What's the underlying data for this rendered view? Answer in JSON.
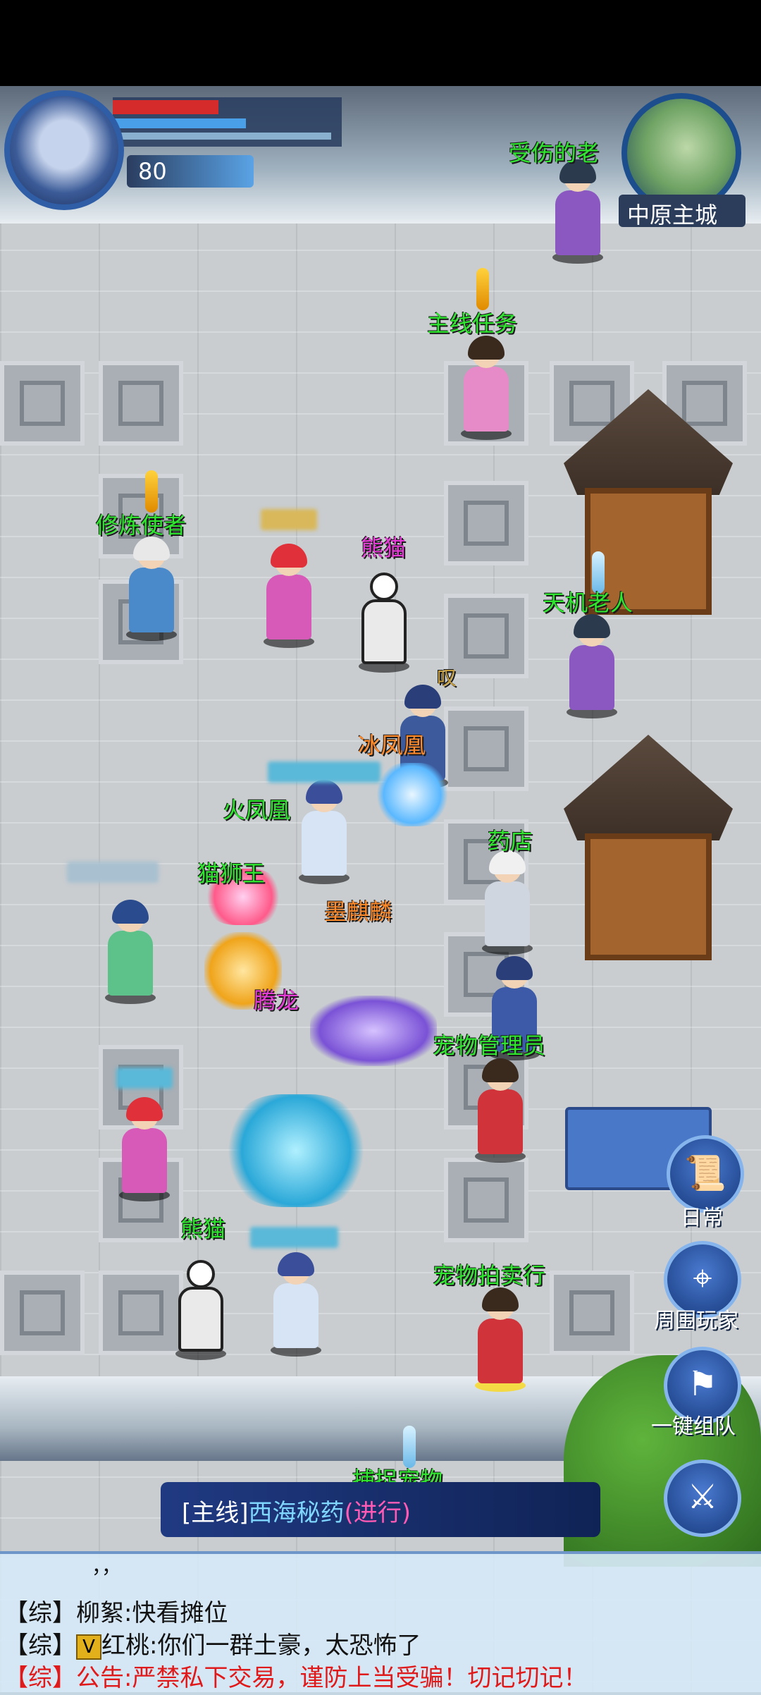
{
  "hud": {
    "level": "80",
    "hp_fraction": 0.46,
    "mp_fraction": 0.58,
    "map_name": "中原主城"
  },
  "labels": {
    "injured_elder": "受伤的老",
    "main_quest": "主线任务",
    "cultivation_envoy": "修炼使者",
    "panda_1": "熊猫",
    "tianji_elder": "天机老人",
    "ice_phoenix": "冰凤凰",
    "fire_phoenix": "火凤凰",
    "pharmacy": "药店",
    "cat_lion_king": "猫狮王",
    "ink_qilin": "墨麒麟",
    "soaring_dragon": "腾龙",
    "pet_manager": "宠物管理员",
    "panda_2": "熊猫",
    "pet_auction": "宠物拍卖行",
    "capture_pet": "捕捉宠物",
    "market_char": "叹"
  },
  "side_buttons": {
    "daily": "日常",
    "nearby_players": "周围玩家",
    "one_click_team": "一键组队"
  },
  "quest": {
    "type": "[主线]",
    "name": "西海秘药",
    "status": "(进行)"
  },
  "chat": {
    "line0": "，，",
    "line1": "【综】柳絮:快看摊位",
    "line2_prefix": "【综】",
    "line2_badge": "V",
    "line2_text": "红桃:你们一群土豪，太恐怖了",
    "line3": "【综】公告:严禁私下交易，谨防上当受骗！切记切记！"
  },
  "colors": {
    "npc_label": "#2ee62e",
    "pet_label": "#ff8a2a",
    "pink_label": "#e83ad8",
    "announcement": "#e01a1a"
  }
}
